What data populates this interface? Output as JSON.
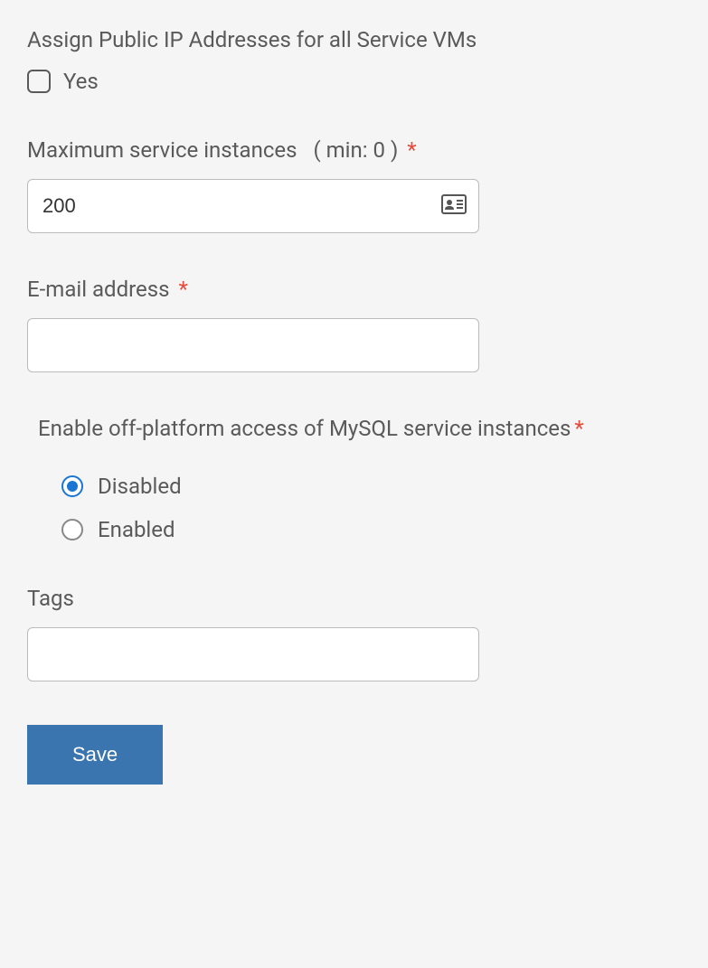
{
  "assignIp": {
    "label": "Assign Public IP Addresses for all Service VMs",
    "checkboxLabel": "Yes"
  },
  "maxInstances": {
    "label": "Maximum service instances",
    "hint": "( min: 0 )",
    "value": "200"
  },
  "email": {
    "label": "E-mail address",
    "value": ""
  },
  "offPlatform": {
    "label": "Enable off-platform access of MySQL service instances",
    "options": {
      "disabled": "Disabled",
      "enabled": "Enabled"
    }
  },
  "tags": {
    "label": "Tags",
    "value": ""
  },
  "saveButton": "Save"
}
